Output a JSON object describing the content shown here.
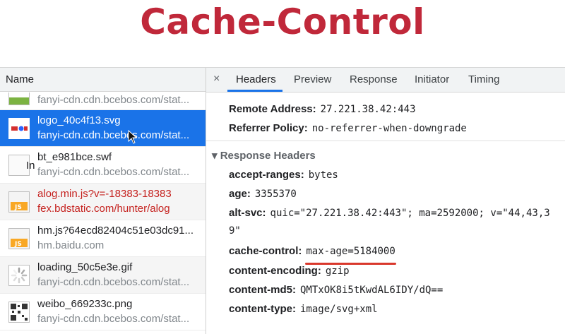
{
  "slide_title": "Cache-Control",
  "left_panel": {
    "column_header": "Name",
    "rows": [
      {
        "name": "",
        "host": "fanyi-cdn.cdn.bcebos.com/stat...",
        "icon": "css-file-icon",
        "state": "normal"
      },
      {
        "name": "logo_40c4f13.svg",
        "host": "fanyi-cdn.cdn.bcebos.com/stat...",
        "icon": "baidu-logo-thumbnail",
        "state": "selected"
      },
      {
        "name": "bt_e981bce.swf",
        "host": "fanyi-cdn.cdn.bcebos.com/stat...",
        "icon": "blank-file-icon",
        "state": "normal",
        "overlay": "In"
      },
      {
        "name": "alog.min.js?v=-18383-18383",
        "host": "fex.bdstatic.com/hunter/alog",
        "icon": "js-file-icon",
        "state": "error"
      },
      {
        "name": "hm.js?64ecd82404c51e03dc91...",
        "host": "hm.baidu.com",
        "icon": "js-file-icon",
        "state": "normal"
      },
      {
        "name": "loading_50c5e3e.gif",
        "host": "fanyi-cdn.cdn.bcebos.com/stat...",
        "icon": "loading-spinner-icon",
        "state": "normal"
      },
      {
        "name": "weibo_669233c.png",
        "host": "fanyi-cdn.cdn.bcebos.com/stat...",
        "icon": "qr-code-thumbnail",
        "state": "normal"
      }
    ]
  },
  "right_panel": {
    "close_symbol": "×",
    "tabs": [
      "Headers",
      "Preview",
      "Response",
      "Initiator",
      "Timing"
    ],
    "active_tab": "Headers",
    "general": [
      {
        "key": "Remote Address:",
        "value": "27.221.38.42:443"
      },
      {
        "key": "Referrer Policy:",
        "value": "no-referrer-when-downgrade"
      }
    ],
    "response_headers_title": "▾ Response Headers",
    "response_headers": [
      {
        "key": "accept-ranges:",
        "value": "bytes"
      },
      {
        "key": "age:",
        "value": "3355370"
      },
      {
        "key": "alt-svc:",
        "value": "quic=\"27.221.38.42:443\"; ma=2592000; v=\"44,43,3"
      },
      {
        "key": "",
        "value": "9\""
      },
      {
        "key": "cache-control:",
        "value": "max-age=5184000"
      },
      {
        "key": "content-encoding:",
        "value": "gzip"
      },
      {
        "key": "content-md5:",
        "value": "QMTxOK8i5tKwdAL6IDY/dQ=="
      },
      {
        "key": "content-type:",
        "value": "image/svg+xml"
      }
    ]
  },
  "colors": {
    "title": "#c0283a",
    "selection": "#1a73e8",
    "error": "#c5221f",
    "annotation": "#d9382c"
  }
}
